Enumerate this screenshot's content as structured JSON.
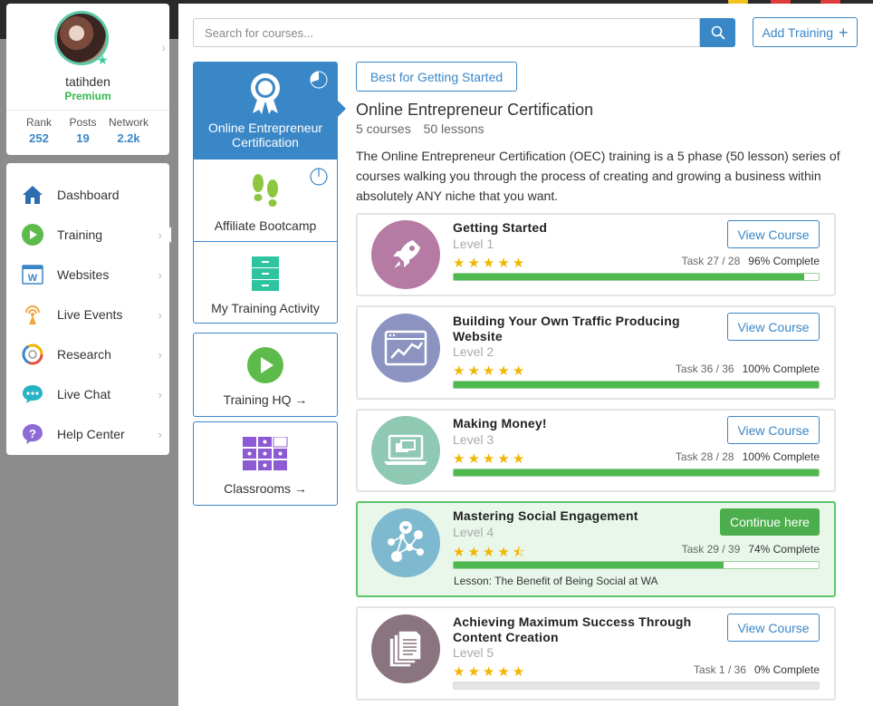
{
  "colors": {
    "accent": "#3a87c7",
    "success": "#4fb84f",
    "premium": "#35b84f"
  },
  "profile": {
    "username": "tatihden",
    "membership": "Premium",
    "stats": [
      {
        "label": "Rank",
        "value": "252"
      },
      {
        "label": "Posts",
        "value": "19"
      },
      {
        "label": "Network",
        "value": "2.2k"
      }
    ]
  },
  "nav": {
    "items": [
      {
        "label": "Dashboard",
        "icon": "house-icon",
        "chevron": false
      },
      {
        "label": "Training",
        "icon": "play-icon",
        "chevron": true,
        "active": true
      },
      {
        "label": "Websites",
        "icon": "website-icon",
        "chevron": true
      },
      {
        "label": "Live Events",
        "icon": "broadcast-icon",
        "chevron": true
      },
      {
        "label": "Research",
        "icon": "research-icon",
        "chevron": true
      },
      {
        "label": "Live Chat",
        "icon": "chat-icon",
        "chevron": true
      },
      {
        "label": "Help Center",
        "icon": "help-icon",
        "chevron": true
      }
    ]
  },
  "search": {
    "placeholder": "Search for courses..."
  },
  "toolbar": {
    "add_training": "Add Training"
  },
  "categories": {
    "oec": "Online Entrepreneur Certification",
    "bootcamp": "Affiliate Bootcamp",
    "activity": "My Training Activity",
    "hq": "Training HQ",
    "classrooms": "Classrooms",
    "arrow": "→"
  },
  "main": {
    "best_button": "Best for Getting Started",
    "title": "Online Entrepreneur Certification",
    "courses_count": "5 courses",
    "lessons_count": "50 lessons",
    "description": "The Online Entrepreneur Certification (OEC) training is a 5 phase (50 lesson) series of courses walking you through the process of creating and growing a business within absolutely ANY niche that you want."
  },
  "courses": [
    {
      "name": "Getting Started",
      "level": "Level 1",
      "tasks": "Task 27 / 28",
      "percent_label": "96% Complete",
      "progress": 0.96,
      "stars": "★★★★★",
      "button": "View Course",
      "icon": "rocket-icon"
    },
    {
      "name": "Building Your Own Traffic Producing Website",
      "level": "Level 2",
      "tasks": "Task 36 / 36",
      "percent_label": "100% Complete",
      "progress": 1.0,
      "stars": "★★★★★",
      "button": "View Course",
      "icon": "website-chart-icon"
    },
    {
      "name": "Making Money!",
      "level": "Level 3",
      "tasks": "Task 28 / 28",
      "percent_label": "100% Complete",
      "progress": 1.0,
      "stars": "★★★★★",
      "button": "View Course",
      "icon": "laptop-payment-icon"
    },
    {
      "name": "Mastering Social Engagement",
      "level": "Level 4",
      "tasks": "Task 29 / 39",
      "percent_label": "74% Complete",
      "progress": 0.74,
      "stars": "★★★★⯪",
      "button": "Continue here",
      "lesson": "Lesson: The Benefit of Being Social at WA",
      "icon": "social-network-icon"
    },
    {
      "name": "Achieving Maximum Success Through Content Creation",
      "level": "Level 5",
      "tasks": "Task 1 / 36",
      "percent_label": "0% Complete",
      "progress": 0.0,
      "stars": "★★★★★",
      "button": "View Course",
      "icon": "documents-icon"
    }
  ]
}
